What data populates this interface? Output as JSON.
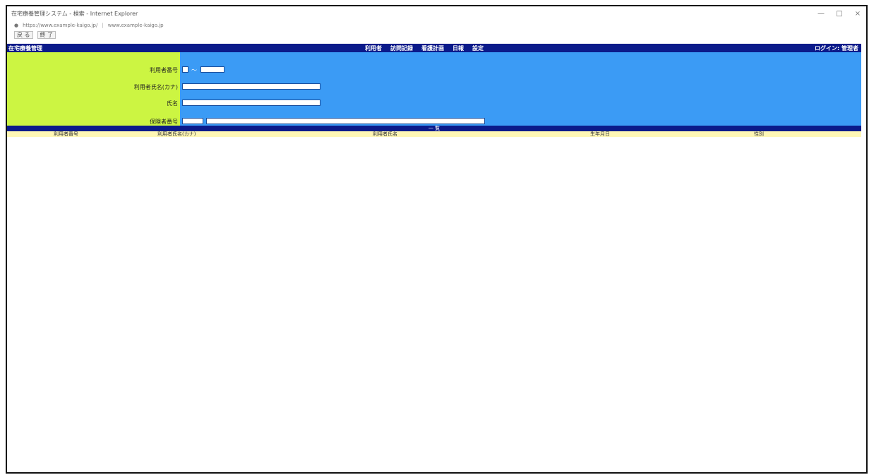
{
  "window": {
    "title": "在宅療養管理システム - 検索 - Internet Explorer",
    "controls": [
      "—",
      "□",
      "×"
    ]
  },
  "address": {
    "url": "https://www.example-kaigo.jp/",
    "extra": "www.example-kaigo.jp"
  },
  "toolbar": {
    "items": [
      "戻 る",
      "終 了"
    ]
  },
  "app": {
    "system_name": "在宅療養管理",
    "menu": [
      "利用者",
      "訪問記録",
      "看護計画",
      "日報",
      "設定"
    ],
    "user": "ログイン: 管理者"
  },
  "form": {
    "labels": {
      "usage_no": "利用者番号",
      "name_kana": "利用者氏名(カナ)",
      "name": "氏名",
      "insurer_no": "保険者番号"
    },
    "values": {
      "usage_no_sep": "〜",
      "usage_no_from": "",
      "usage_no_to": "",
      "name_kana": "",
      "name": "",
      "insurer_code": "",
      "insurer_name": ""
    }
  },
  "list": {
    "title": "一 覧",
    "columns": [
      "利用者番号",
      "利用者氏名(カナ)",
      "利用者氏名",
      "生年月日",
      "性別"
    ]
  }
}
